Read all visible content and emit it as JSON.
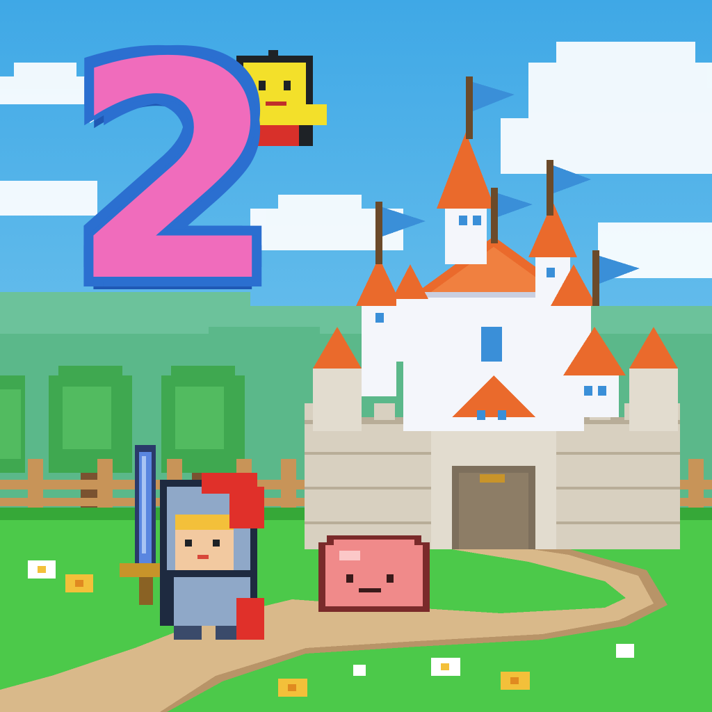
{
  "logo": {
    "text": "2"
  },
  "colors": {
    "sky_top": "#3fa8e6",
    "sky_bottom": "#8fd4f2",
    "hill": "#5bb88a",
    "grass": "#4cc94a",
    "grass_dark": "#36a838",
    "path": "#d9b98a",
    "path_edge": "#b89468",
    "castle_stone": "#d8d0c0",
    "castle_stone_dark": "#b8ad98",
    "roof": "#ea6a2c",
    "roof_dark": "#c44a18",
    "castle_white": "#f4f6fb",
    "flag": "#3a8fd8",
    "logo_pink": "#f06cbc",
    "logo_blue": "#2b6fd0",
    "slime": "#f08a8a",
    "knight_armor": "#8fa8c8",
    "knight_plume": "#e0302a",
    "sword_blade": "#5a86e0",
    "tree": "#3fa850",
    "fence": "#c89458"
  },
  "icons": [
    "castle-icon",
    "knight-icon",
    "slime-icon",
    "mascot-icon",
    "flag-icon",
    "tree-icon",
    "flower-icon"
  ]
}
